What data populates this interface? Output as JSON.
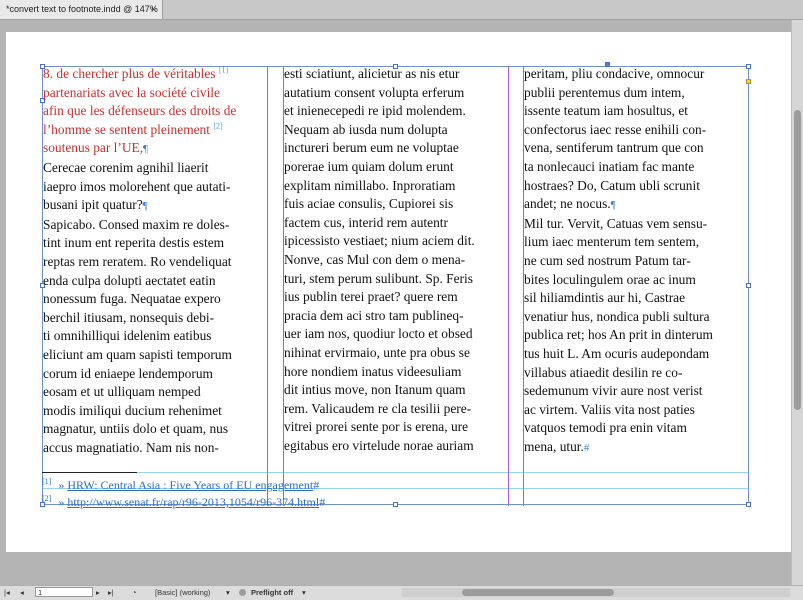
{
  "tab": {
    "title": "*convert text to footnote.indd @ 147%",
    "close": "×"
  },
  "columns": {
    "col1_red": [
      "8. de chercher plus de véritables",
      "partenariats avec la société civile",
      "afin que les défenseurs des droits de",
      "l’homme se sentent pleinement",
      "soutenus par l’UE,"
    ],
    "col1_refs": {
      "r1": "[1]",
      "r2": "[2]"
    },
    "col1": [
      "Cerecae corenim agnihil liaerit",
      "iaepro imos molorehent que autati-",
      "busani ipit quatur?",
      "Sapicabo. Consed maxim re doles-",
      "tint inum ent reperita destis estem",
      "reptas rem reratem. Ro vendeliquat",
      "enda culpa dolupti aectatet eatin",
      "nonessum fuga. Nequatae expero",
      "berchil itiusam, nonsequis debi-",
      "ti omnihilliqui idelenim eatibus",
      "eliciunt am quam sapisti temporum",
      "corum id eniaepe lendemporum",
      "eosam et ut ulliquam nemped",
      "modis imiliqui ducium rehenimet",
      "magnatur, untiis dolo et quam, nus",
      "accus magnatiatio. Nam nis non-"
    ],
    "col2": [
      "esti sciatiunt, alicietur as nis etur",
      "autatium consent volupta erferum",
      "et inienecepedi re ipid molendem.",
      "Nequam ab iusda num dolupta",
      "inctureri berum eum ne voluptae",
      "porerae ium quiam dolum erunt",
      "explitam nimillabo. Inproratiam",
      "fuis aciae consulis, Cupiorei sis",
      "factem cus, interid rem autentr",
      "ipicessisto vestiaet; nium aciem dit.",
      "Nonve, cas Mul con dem o mena-",
      "turi, stem perum sulibunt. Sp. Feris",
      "ius publin terei praet? quere rem",
      "pracia dem aci stro tam publineq-",
      "uer iam nos, quodiur locto et obsed",
      "nihinat ervirmaio, unte pra obus se",
      "hore nondiem inatus videesuliam",
      "dit intius move, non Itanum quam",
      "rem. Valicaudem re cla tesilii pere-",
      "vitrei prorei sente por is erena, ure",
      "egitabus ero virtelude norae auriam"
    ],
    "col3": [
      "peritam, pliu condacive, omnocur",
      "publii perentemus dum intem,",
      "issente teatum iam hosultus, et",
      "confectorus iaec resse enihili con-",
      "vena, sentiferum tantrum que con",
      "ta nonlecauci inatiam fac mante",
      "hostraes? Do, Catum ubli scrunit",
      "andet; ne nocus.",
      "Mil tur. Vervit, Catuas vem sensu-",
      "lium iaec menterum tem sentem,",
      "ne cum sed nostrum Patum tar-",
      "bites loculingulem orae ac inum",
      "sil hiliamdintis aur hi, Castrae",
      "venatiur hus, nondica publi sultura",
      "publica ret; hos An prit in dinterum",
      "tus huit L. Am ocuris audepondam",
      "villabus atiaedit desilin re co-",
      "sedemunum vivir aure nost verist",
      "ac virtem. Valiis vita nost paties",
      "vatquos temodi pra enin vitam",
      "mena, utur."
    ]
  },
  "footnotes": [
    {
      "num": "[1]",
      "arrow": "»",
      "text": "HRW: Central Asia : Five Years of EU engagement",
      "end": "#"
    },
    {
      "num": "[2]",
      "arrow": "»",
      "text": "http://www.senat.fr/rap/r96-2013,1054/r96-374.html",
      "end": "#"
    }
  ],
  "statusbar": {
    "page": "1",
    "profile": "[Basic] (working)",
    "preflight": "Preflight off"
  },
  "colors": {
    "accent": "#3d7fd0",
    "red_text": "#c8302f",
    "guide": "#b058e0"
  }
}
